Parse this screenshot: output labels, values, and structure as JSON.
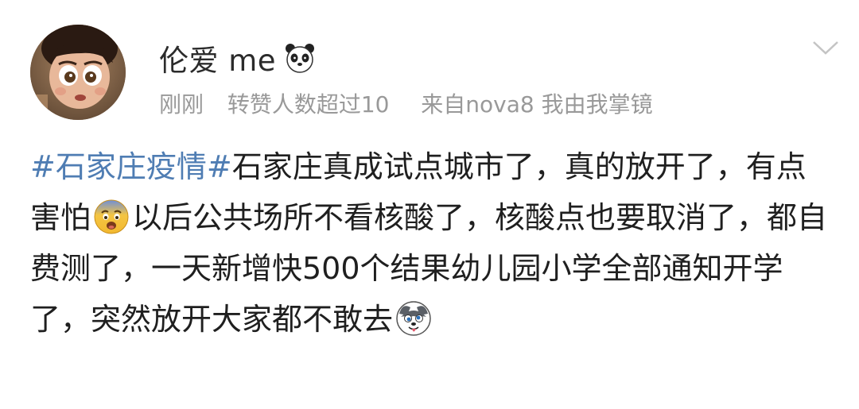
{
  "post": {
    "username": "伦爱 me",
    "username_emoji": "panda-emoji",
    "meta": {
      "time": "刚刚",
      "reposts_likes": "转赞人数超过10",
      "source": "来自nova8 我由我掌镜"
    },
    "body": {
      "hashtag": "#石家庄疫情#",
      "text_1": "石家庄真成试点城市了，真的放开了，有点害怕",
      "emoji_1": "fearful-face-emoji",
      "text_2": "以后公共场所不看核酸了，核酸点也要取消了，都自费测了，一天新增快500个结果幼儿园小学全部通知开学了，突然放开大家都不敢去",
      "emoji_2": "husky-dog-emoji"
    }
  },
  "colors": {
    "hashtag": "#4f7db3",
    "meta": "#999999",
    "text": "#1f1f1f"
  }
}
